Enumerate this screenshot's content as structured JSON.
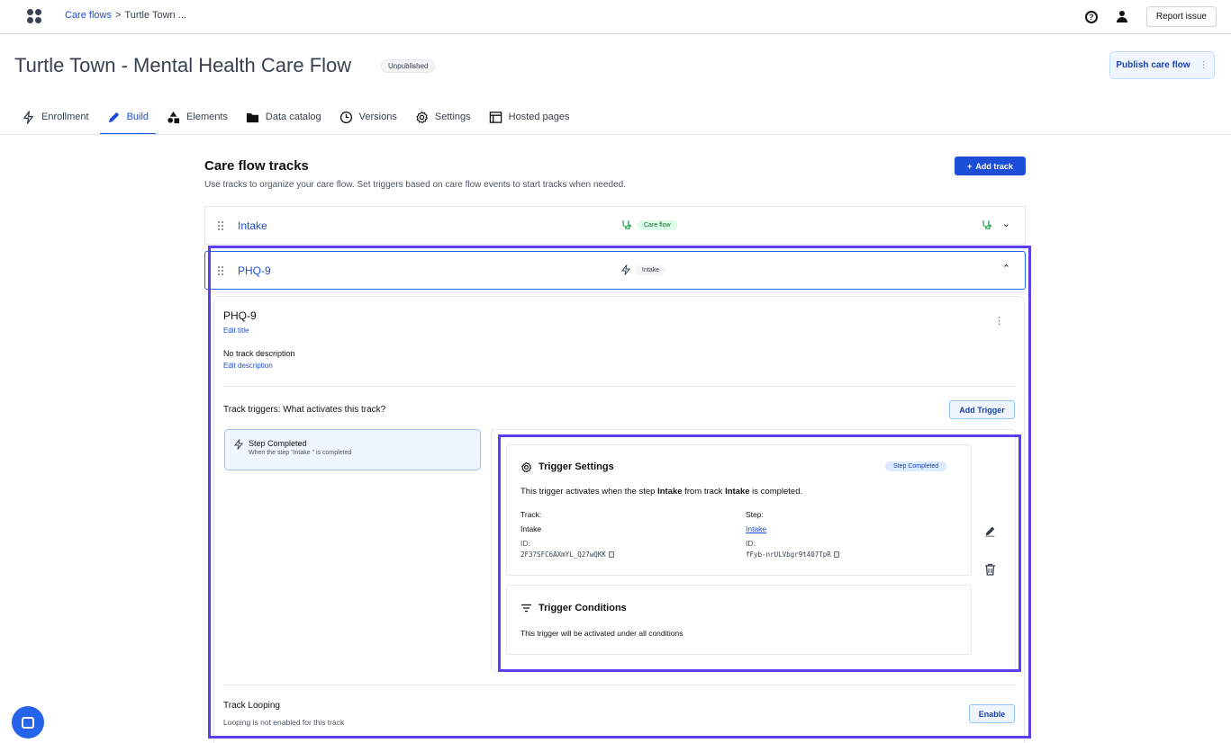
{
  "breadcrumb": {
    "root": "Care flows",
    "separator": ">",
    "current": "Turtle Town ..."
  },
  "topbar": {
    "help_glyph": "?",
    "report_issue": "Report issue"
  },
  "page": {
    "title": "Turtle Town - Mental Health Care Flow",
    "status_badge": "Unpublished",
    "publish_button": "Publish care flow",
    "publish_menu": "⋮"
  },
  "tabs": [
    {
      "label": "Enrollment",
      "icon": "lightning-icon"
    },
    {
      "label": "Build",
      "icon": "pencil-icon",
      "active": true
    },
    {
      "label": "Elements",
      "icon": "shapes-icon"
    },
    {
      "label": "Data catalog",
      "icon": "folder-icon"
    },
    {
      "label": "Versions",
      "icon": "clock-icon"
    },
    {
      "label": "Settings",
      "icon": "gear-icon"
    },
    {
      "label": "Hosted pages",
      "icon": "browser-icon"
    }
  ],
  "tracks_section": {
    "title": "Care flow tracks",
    "subtitle": "Use tracks to organize your care flow. Set triggers based on care flow events to start tracks when needed.",
    "add_track": "Add track",
    "add_track_plus": "+"
  },
  "tracks": [
    {
      "name": "Intake",
      "trigger_label": "Care flow",
      "expanded": false,
      "chevron": "⌄"
    },
    {
      "name": "PHQ-9",
      "trigger_label": "Intake",
      "expanded": true,
      "chevron": "⌃"
    }
  ],
  "detail": {
    "title": "PHQ-9",
    "edit_title": "Edit title",
    "description": "No track description",
    "edit_description": "Edit description",
    "kebab": "⋮",
    "triggers_heading": "Track triggers: What activates this track?",
    "add_trigger": "Add Trigger",
    "trigger_item": {
      "title": "Step Completed",
      "subtitle": "When the step \"Intake \" is completed"
    },
    "settings": {
      "title": "Trigger Settings",
      "badge": "Step Completed",
      "desc_pre": "This trigger activates when the step ",
      "desc_step": "Intake",
      "desc_mid": " from track ",
      "desc_track": "Intake",
      "desc_post": " is completed.",
      "track_label": "Track:",
      "track_value": "Intake",
      "track_id_label": "ID:",
      "track_id": "2F37SFC6AXmYL_Q27wQKK",
      "step_label": "Step:",
      "step_value": "Intake",
      "step_id_label": "ID:",
      "step_id": "fFyb-nrULVbgr9t407TpR"
    },
    "conditions": {
      "title": "Trigger Conditions",
      "description": "This trigger will be activated under all conditions"
    },
    "looping": {
      "title": "Track Looping",
      "description": "Looping is not enabled for this track",
      "enable": "Enable"
    }
  },
  "colors": {
    "accent": "#1d4ed8",
    "highlight": "#5b3ff0",
    "success": "#166534"
  }
}
